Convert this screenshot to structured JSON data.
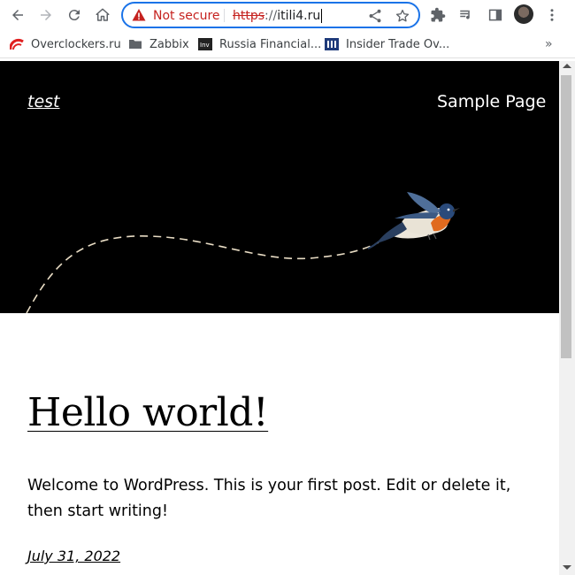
{
  "browser": {
    "omnibox": {
      "security_label": "Not secure",
      "url_scheme": "https",
      "url_sep": "://",
      "url_host": "itili4.ru"
    },
    "bookmarks": [
      {
        "label": "Overclockers.ru",
        "icon": "overclockers-icon"
      },
      {
        "label": "Zabbix",
        "icon": "folder-icon"
      },
      {
        "label": "Russia Financial...",
        "icon": "investing-icon"
      },
      {
        "label": "Insider Trade Ov...",
        "icon": "insider-icon"
      }
    ],
    "overflow_label": "»"
  },
  "site": {
    "title": "test",
    "nav": [
      "Sample Page"
    ],
    "hero_bg": "#000000"
  },
  "post": {
    "title": "Hello world!",
    "body": "Welcome to WordPress. This is your first post. Edit or delete it, then start writing!",
    "date": "July 31, 2022"
  },
  "colors": {
    "accent": "#1a73e8",
    "warning": "#c5221f"
  }
}
